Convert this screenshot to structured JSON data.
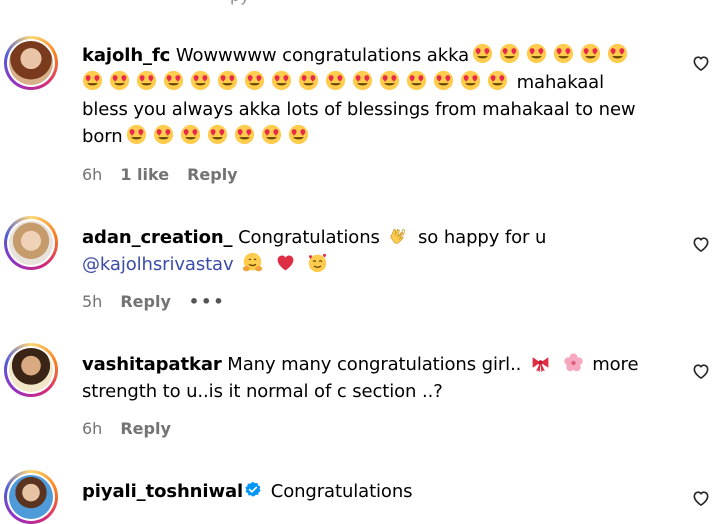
{
  "top_fragment": "py",
  "comments": [
    {
      "username": "kajolh_fc",
      "text_1": "Wowwwww congratulations akka",
      "text_2": "mahakaal",
      "text_3": "bless you always akka lots of blessings from mahakaal to new",
      "text_4": "born",
      "time": "6h",
      "likes": "1 like",
      "reply": "Reply"
    },
    {
      "username": "adan_creation_",
      "text_1": "Congratulations",
      "text_2": "so happy for u",
      "mention": "@kajolhsrivastav",
      "time": "5h",
      "reply": "Reply",
      "more": "•••"
    },
    {
      "username": "vashitapatkar",
      "text_1": "Many many congratulations girl..",
      "text_2": "more",
      "text_3": "strength to u..is it normal of c section ..?",
      "time": "6h",
      "reply": "Reply"
    },
    {
      "username": "piyali_toshniwal",
      "text_1": "Congratulations"
    }
  ],
  "icons": [
    "heart-outline-icon",
    "heart-eyes-emoji",
    "raising-hands-emoji",
    "hugging-face-emoji",
    "red-heart-emoji",
    "smiling-hearts-emoji",
    "ribbon-emoji",
    "cherry-blossom-emoji",
    "verified-badge-icon"
  ],
  "colors": {
    "mention": "#3b4ba8",
    "meta": "#737373",
    "verified": "#0095f6"
  }
}
